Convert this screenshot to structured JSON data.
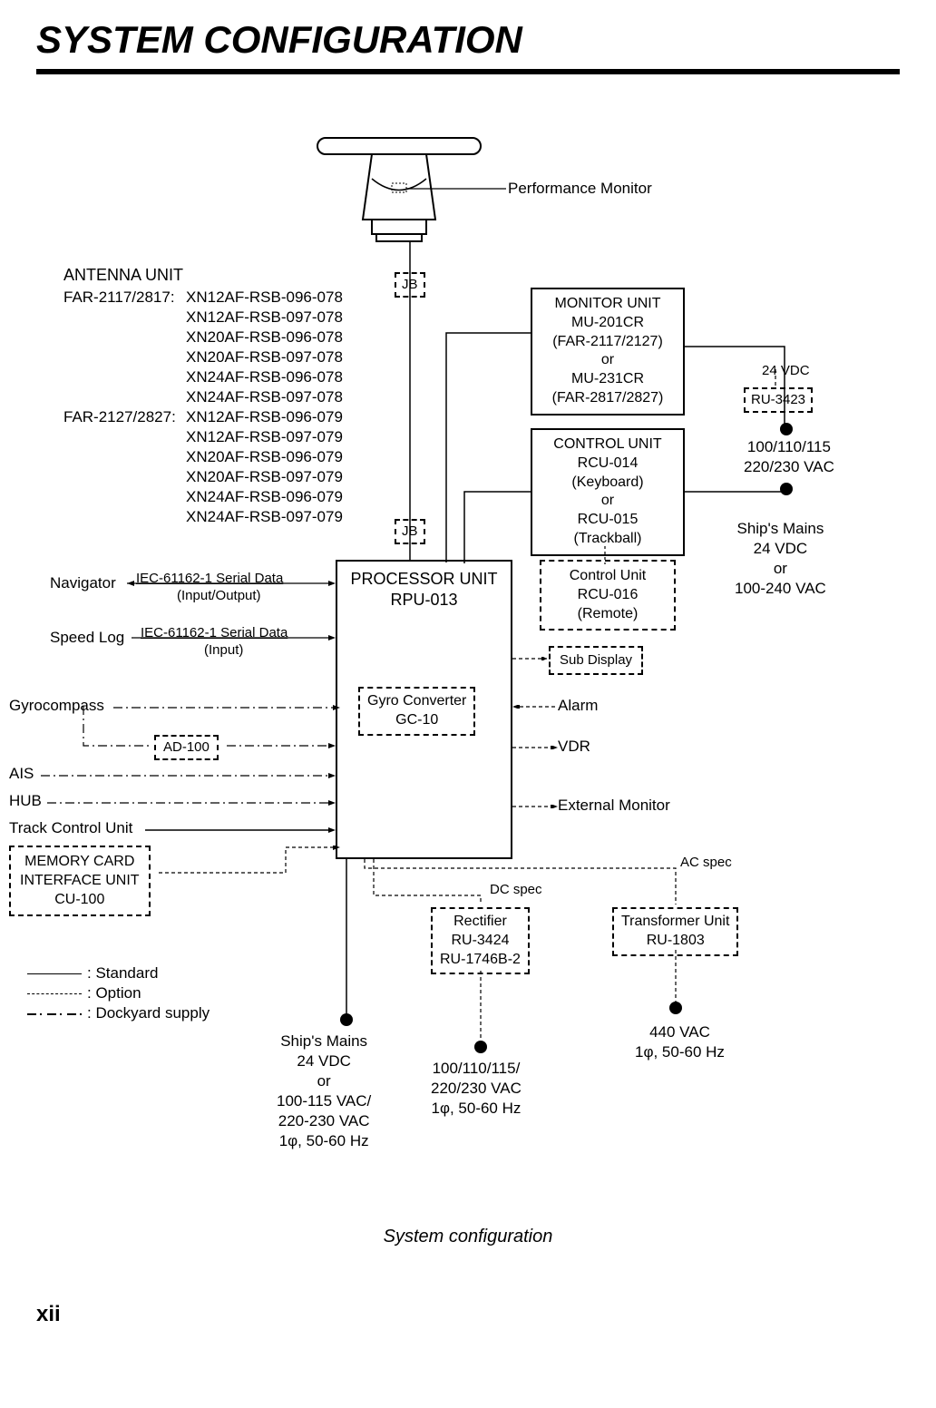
{
  "title": "SYSTEM CONFIGURATION",
  "antenna": {
    "heading": "ANTENNA UNIT",
    "group1_label": "FAR-2117/2817:",
    "group1_items": [
      "XN12AF-RSB-096-078",
      "XN12AF-RSB-097-078",
      "XN20AF-RSB-096-078",
      "XN20AF-RSB-097-078",
      "XN24AF-RSB-096-078",
      "XN24AF-RSB-097-078"
    ],
    "group2_label": "FAR-2127/2827:",
    "group2_items": [
      "XN12AF-RSB-096-079",
      "XN12AF-RSB-097-079",
      "XN20AF-RSB-096-079",
      "XN20AF-RSB-097-079",
      "XN24AF-RSB-096-079",
      "XN24AF-RSB-097-079"
    ]
  },
  "perf_monitor": "Performance Monitor",
  "jb": "JB",
  "monitor_unit": "MONITOR UNIT\nMU-201CR\n(FAR-2117/2127)\nor\nMU-231CR\n(FAR-2817/2827)",
  "control_unit": "CONTROL UNIT\nRCU-014\n(Keyboard)\nor\nRCU-015\n(Trackball)",
  "control_unit2": "Control Unit\nRCU-016\n(Remote)",
  "ru3423": "RU-3423",
  "vdc24": "24 VDC",
  "ac_supply1": "100/110/115\n220/230 VAC",
  "ships_mains_right": "Ship's Mains\n24 VDC\nor\n100-240 VAC",
  "processor": "PROCESSOR UNIT\nRPU-013",
  "gyro_converter": "Gyro Converter\nGC-10",
  "ad100": "AD-100",
  "memory_card": "MEMORY CARD\nINTERFACE UNIT\nCU-100",
  "sub_display": "Sub Display",
  "alarm": "Alarm",
  "vdr": "VDR",
  "ext_monitor": "External Monitor",
  "ac_spec": "AC spec",
  "dc_spec": "DC spec",
  "rectifier": "Rectifier\nRU-3424\nRU-1746B-2",
  "transformer": "Transformer Unit\nRU-1803",
  "ships_mains_left": "Ship's Mains\n24 VDC\nor\n100-115 VAC/\n220-230 VAC\n1φ, 50-60 Hz",
  "supply_mid": "100/110/115/\n220/230 VAC\n1φ, 50-60 Hz",
  "supply_right": "440 VAC\n1φ, 50-60 Hz",
  "inputs": {
    "navigator": "Navigator",
    "navigator_spec": "IEC-61162-1 Serial Data",
    "navigator_io": "(Input/Output)",
    "speed_log": "Speed Log",
    "speed_log_spec": "IEC-61162-1 Serial Data",
    "speed_log_io": "(Input)",
    "gyro": "Gyrocompass",
    "ais": "AIS",
    "hub": "HUB",
    "track": "Track Control Unit"
  },
  "legend": {
    "standard": ": Standard",
    "option": ": Option",
    "dockyard": ": Dockyard supply"
  },
  "caption": "System configuration",
  "page": "xii"
}
